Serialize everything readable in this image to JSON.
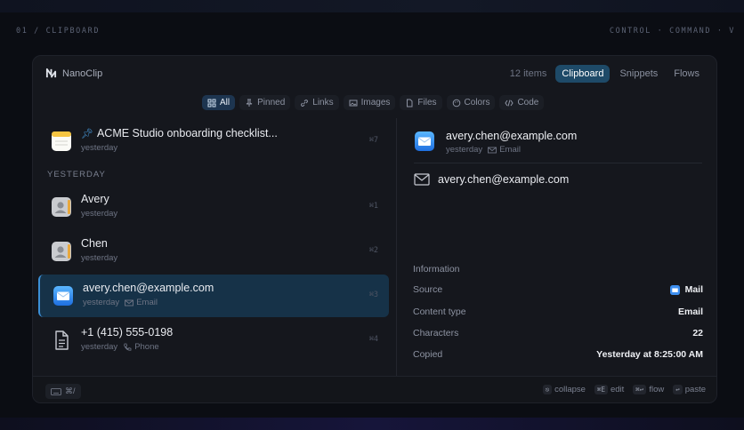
{
  "corner": {
    "left": "01 / CLIPBOARD",
    "right": "CONTROL · COMMAND · V"
  },
  "app": {
    "name": "NanoClip"
  },
  "header": {
    "count": "12 items",
    "tabs": [
      {
        "label": "Clipboard",
        "active": true
      },
      {
        "label": "Snippets",
        "active": false
      },
      {
        "label": "Flows",
        "active": false
      }
    ]
  },
  "filters": [
    {
      "label": "All",
      "icon": "grid-icon",
      "active": true
    },
    {
      "label": "Pinned",
      "icon": "pin-icon",
      "active": false
    },
    {
      "label": "Links",
      "icon": "link-icon",
      "active": false
    },
    {
      "label": "Images",
      "icon": "image-icon",
      "active": false
    },
    {
      "label": "Files",
      "icon": "file-icon",
      "active": false
    },
    {
      "label": "Colors",
      "icon": "palette-icon",
      "active": false
    },
    {
      "label": "Code",
      "icon": "code-icon",
      "active": false
    }
  ],
  "list": {
    "section": "YESTERDAY",
    "items": [
      {
        "title": "ACME Studio onboarding checklist...",
        "time": "yesterday",
        "kind": "",
        "shortcut": "⌘7",
        "icon": "notes-icon",
        "pinned": true
      },
      {
        "title": "Avery",
        "time": "yesterday",
        "kind": "",
        "shortcut": "⌘1",
        "icon": "contact-icon",
        "pinned": false
      },
      {
        "title": "Chen",
        "time": "yesterday",
        "kind": "",
        "shortcut": "⌘2",
        "icon": "contact-icon",
        "pinned": false
      },
      {
        "title": "avery.chen@example.com",
        "time": "yesterday",
        "kind": "Email",
        "shortcut": "⌘3",
        "icon": "mail-app-icon",
        "pinned": false,
        "selected": true
      },
      {
        "title": "+1 (415) 555-0198",
        "time": "yesterday",
        "kind": "Phone",
        "shortcut": "⌘4",
        "icon": "document-icon",
        "pinned": false
      }
    ]
  },
  "detail": {
    "title": "avery.chen@example.com",
    "time": "yesterday",
    "kind": "Email",
    "preview": "avery.chen@example.com",
    "info_heading": "Information",
    "rows": [
      {
        "label": "Source",
        "value": "Mail"
      },
      {
        "label": "Content type",
        "value": "Email"
      },
      {
        "label": "Characters",
        "value": "22"
      },
      {
        "label": "Copied",
        "value": "Yesterday at 8:25:00 AM"
      }
    ]
  },
  "footer": {
    "hint": "⌘/",
    "actions": [
      {
        "key": "⎋",
        "label": "collapse"
      },
      {
        "key": "⌘E",
        "label": "edit"
      },
      {
        "key": "⌘↩",
        "label": "flow"
      },
      {
        "key": "↩",
        "label": "paste"
      }
    ]
  },
  "colors": {
    "accent": "#1e4a68",
    "selected": "#163248",
    "bar": "#3b8fd6"
  }
}
